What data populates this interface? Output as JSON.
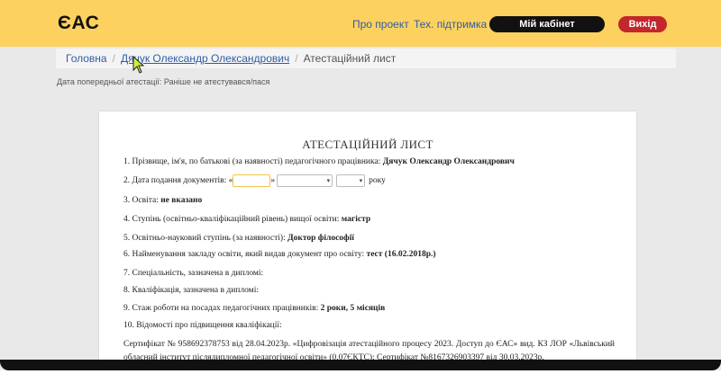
{
  "header": {
    "logo": "ЄАС",
    "about_link": "Про проект",
    "support_link": "Тех. підтримка",
    "cabinet_button": "Мій кабінет",
    "exit_button": "Вихід"
  },
  "breadcrumb": {
    "home": "Головна",
    "person": "Дячук Олександр Олександрович",
    "current": "Атестаційний лист"
  },
  "prev_attestation": "Дата попередньої атестації: Раніше не атестувався/пася",
  "document": {
    "title": "АТЕСТАЦІЙНИЙ ЛИСТ",
    "l1_label": "1. Прізвище, ім'я, по батькові (за наявності) педагогічного працівника:",
    "l1_value": "Дячук Олександр Олександрович",
    "l2_label": "2. Дата подання документів: «",
    "l2_mid": "»",
    "l2_end": "року",
    "l3_label": "3. Освіта:",
    "l3_value": "не вказано",
    "l4_label": "4. Ступінь (освітньо-кваліфікаційний рівень) вищої освіти:",
    "l4_value": "магістр",
    "l5_label": "5. Освітньо-науковий ступінь (за наявності):",
    "l5_value": "Доктор філософії",
    "l6_label": "6. Найменування закладу освіти, який видав документ про освіту:",
    "l6_value": "тест (16.02.2018р.)",
    "l7_label": "7. Спеціальність, зазначена в дипломі:",
    "l8_label": "8. Кваліфікація, зазначена в дипломі:",
    "l9_label": "9. Стаж роботи на посадах педагогічних працівників:",
    "l9_value": "2 роки, 5 місяців",
    "l10_label": "10. Відомості про підвищення кваліфікації:",
    "cert_text": "Сертифікат № 958692378753 від 28.04.2023р. «Цифровізація атестаційного процесу 2023. Доступ до ЄАС» вид. КЗ ЛОР «Львівський обласний інститут післядипломної педагогічної освіти» (0.07ЄКТС); Сертифікат №8167326903397 від 30.03.2023р."
  },
  "colors": {
    "header_bg": "#fcd15f",
    "link": "#2f5ca8",
    "cabinet_btn": "#111111",
    "exit_btn": "#c3262b"
  }
}
